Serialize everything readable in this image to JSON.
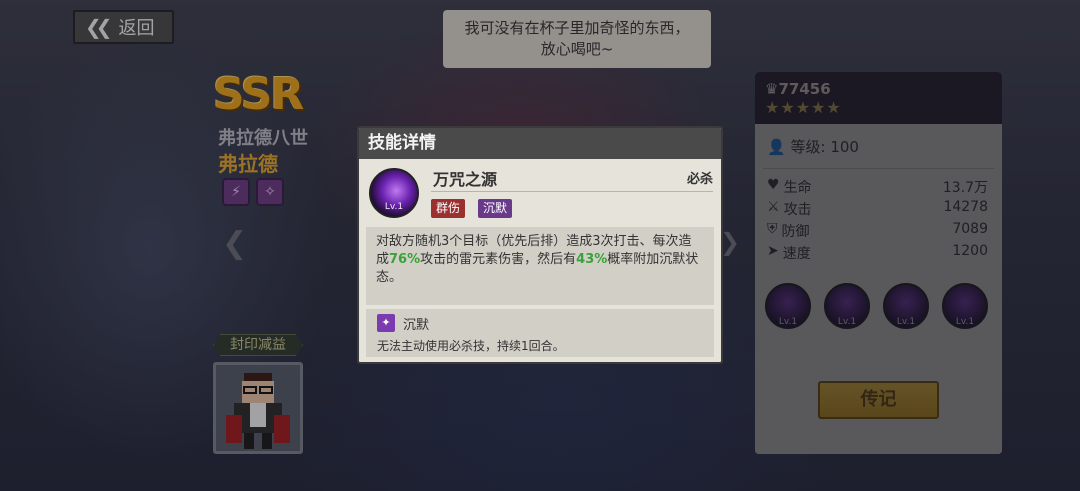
{
  "header": {
    "back_label": "返回",
    "back_icon": "double-chevron-left-icon"
  },
  "speech_bubble": {
    "line1": "我可没有在杯子里加奇怪的东西，",
    "line2": "放心喝吧~"
  },
  "character": {
    "rarity": "SSR",
    "title": "弗拉德八世",
    "name": "弗拉德",
    "seal_label": "封印减益"
  },
  "stats_panel": {
    "power": "77456",
    "stars": "★★★★★",
    "level_label": "等级:",
    "level_value": "100",
    "stats": [
      {
        "label": "生命",
        "value": "13.7万",
        "icon": "heart-icon"
      },
      {
        "label": "攻击",
        "value": "14278",
        "icon": "sword-icon"
      },
      {
        "label": "防御",
        "value": "7089",
        "icon": "shield-icon"
      },
      {
        "label": "速度",
        "value": "1200",
        "icon": "speed-icon"
      }
    ],
    "skill_levels": [
      "Lv.1",
      "Lv.1",
      "Lv.1",
      "Lv.1"
    ],
    "legend_button": "传记"
  },
  "skill_modal": {
    "title": "技能详情",
    "skill_name": "万咒之源",
    "skill_level": "Lv.1",
    "skill_type": "必杀",
    "tags": [
      {
        "label": "群伤",
        "color": "#9a3030"
      },
      {
        "label": "沉默",
        "color": "#6a3a8a"
      }
    ],
    "description": {
      "part1": "对敌方随机3个目标（优先后排）造成3次打击、每次造成",
      "pct1": "76%",
      "part2": "攻击的雷元素伤害，然后有",
      "pct2": "43%",
      "part3": "概率附加沉默状态。"
    },
    "effect": {
      "name": "沉默",
      "description": "无法主动使用必杀技，持续1回合。"
    }
  }
}
